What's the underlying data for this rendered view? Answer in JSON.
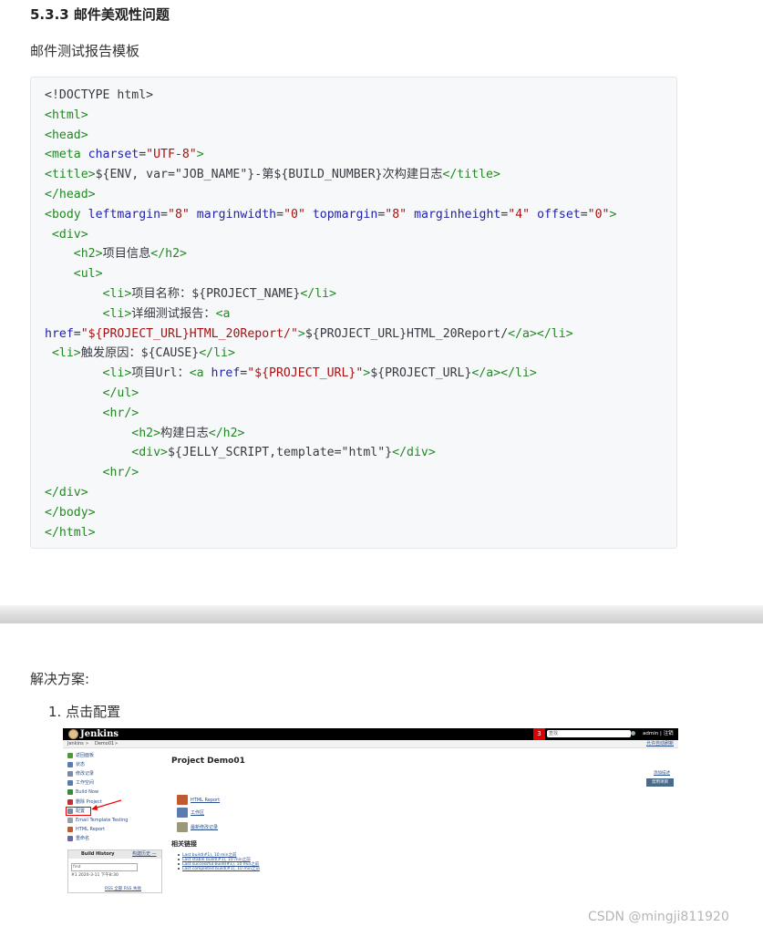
{
  "heading": "5.3.3 邮件美观性问题",
  "subtitle": "邮件测试报告模板",
  "code_lines": [
    [
      [
        "tx",
        "<!DOCTYPE html>"
      ]
    ],
    [
      [
        "tg",
        "<html>"
      ]
    ],
    [
      [
        "tg",
        "<head>"
      ]
    ],
    [
      [
        "tg",
        "<meta "
      ],
      [
        "at",
        "charset"
      ],
      [
        "tx",
        "="
      ],
      [
        "st",
        "\"UTF-8\""
      ],
      [
        "tg",
        ">"
      ]
    ],
    [
      [
        "tg",
        "<title>"
      ],
      [
        "tx",
        "${ENV, var=\"JOB_NAME\"}-第${BUILD_NUMBER}次构建日志"
      ],
      [
        "tg",
        "</title>"
      ]
    ],
    [
      [
        "tg",
        "</head>"
      ]
    ],
    [
      [
        "tg",
        "<body "
      ],
      [
        "at",
        "leftmargin"
      ],
      [
        "tx",
        "="
      ],
      [
        "st",
        "\"8\""
      ],
      [
        "tx",
        " "
      ],
      [
        "at",
        "marginwidth"
      ],
      [
        "tx",
        "="
      ],
      [
        "st",
        "\"0\""
      ],
      [
        "tx",
        " "
      ],
      [
        "at",
        "topmargin"
      ],
      [
        "tx",
        "="
      ],
      [
        "st",
        "\"8\""
      ],
      [
        "tx",
        " "
      ],
      [
        "at",
        "marginheight"
      ],
      [
        "tx",
        "="
      ],
      [
        "st",
        "\"4\""
      ],
      [
        "tx",
        " "
      ],
      [
        "at",
        "offset"
      ],
      [
        "tx",
        "="
      ],
      [
        "st",
        "\"0\""
      ],
      [
        "tg",
        ">"
      ]
    ],
    [
      [
        "tx",
        " "
      ],
      [
        "tg",
        "<div>"
      ]
    ],
    [
      [
        "tx",
        "    "
      ],
      [
        "tg",
        "<h2>"
      ],
      [
        "tx",
        "项目信息"
      ],
      [
        "tg",
        "</h2>"
      ]
    ],
    [
      [
        "tx",
        "    "
      ],
      [
        "tg",
        "<ul>"
      ]
    ],
    [
      [
        "tx",
        "        "
      ],
      [
        "tg",
        "<li>"
      ],
      [
        "tx",
        "项目名称：${PROJECT_NAME}"
      ],
      [
        "tg",
        "</li>"
      ]
    ],
    [
      [
        "tx",
        "        "
      ],
      [
        "tg",
        "<li>"
      ],
      [
        "tx",
        "详细测试报告："
      ],
      [
        "tg",
        "<a"
      ]
    ],
    [
      [
        "at",
        "href"
      ],
      [
        "tx",
        "="
      ],
      [
        "st",
        "\"${PROJECT_URL}HTML_20Report/\""
      ],
      [
        "tg",
        ">"
      ],
      [
        "tx",
        "${PROJECT_URL}HTML_20Report/"
      ],
      [
        "tg",
        "</a></li>"
      ]
    ],
    [
      [
        "tx",
        " "
      ],
      [
        "tg",
        "<li>"
      ],
      [
        "tx",
        "触发原因：${CAUSE}"
      ],
      [
        "tg",
        "</li>"
      ]
    ],
    [
      [
        "tx",
        "        "
      ],
      [
        "tg",
        "<li>"
      ],
      [
        "tx",
        "项目Url："
      ],
      [
        "tg",
        "<a "
      ],
      [
        "at",
        "href"
      ],
      [
        "tx",
        "="
      ],
      [
        "st",
        "\"${PROJECT_URL}\""
      ],
      [
        "tg",
        ">"
      ],
      [
        "tx",
        "${PROJECT_URL}"
      ],
      [
        "tg",
        "</a></li>"
      ]
    ],
    [
      [
        "tx",
        "        "
      ],
      [
        "tg",
        "</ul>"
      ]
    ],
    [
      [
        "tx",
        "        "
      ],
      [
        "tg",
        "<hr/>"
      ]
    ],
    [
      [
        "tx",
        "            "
      ],
      [
        "tg",
        "<h2>"
      ],
      [
        "tx",
        "构建日志"
      ],
      [
        "tg",
        "</h2>"
      ]
    ],
    [
      [
        "tx",
        "            "
      ],
      [
        "tg",
        "<div>"
      ],
      [
        "tx",
        "${JELLY_SCRIPT,template=\"html\"}"
      ],
      [
        "tg",
        "</div>"
      ]
    ],
    [
      [
        "tx",
        "        "
      ],
      [
        "tg",
        "<hr/>"
      ]
    ],
    [
      [
        "tg",
        "</div>"
      ]
    ],
    [
      [
        "tg",
        "</body>"
      ]
    ],
    [
      [
        "tg",
        "</html>"
      ]
    ]
  ],
  "solution_label": "解决方案:",
  "step_label": "1. 点击配置",
  "jenkins": {
    "app_title": "Jenkins",
    "notification_count": "3",
    "search_placeholder": "查找",
    "user": "admin | 注销",
    "breadcrumb": [
      "Jenkins",
      "»",
      "Demo01",
      "»"
    ],
    "breadcrumb_right": "允许自动刷新",
    "side_menu": [
      "返回面板",
      "状态",
      "修改记录",
      "工作空间",
      "Build Now",
      "删除 Project",
      "配置",
      "Email Template Testing",
      "HTML Report",
      "重命名"
    ],
    "side_icon_colors": [
      "#4a9a3a",
      "#5a7ab0",
      "#7a8aa0",
      "#5a7ab0",
      "#3a8a3a",
      "#c03030",
      "#7a8a9a",
      "#9aa0a8",
      "#c05a30",
      "#6a6a9a"
    ],
    "project_title": "Project Demo01",
    "add_description": "添加描述",
    "disable_button": "禁用项目",
    "main_links": [
      "HTML Report",
      "工作区",
      "最新修改记录"
    ],
    "related_title": "相关链接",
    "related_links": [
      "Last build(#1), 10 min之前",
      "Last stable build(#1), 10 min之前",
      "Last successful build(#1), 10 min之前",
      "Last completed build(#1), 10 min之前"
    ],
    "build_history_title": "Build History",
    "build_history_trend": "构建历史 —",
    "build_search": "find",
    "build_row": "#1    2020-3-11 下午8:30",
    "rss_links": "RSS 全部  RSS 失败"
  },
  "watermark": "CSDN @mingji811920"
}
